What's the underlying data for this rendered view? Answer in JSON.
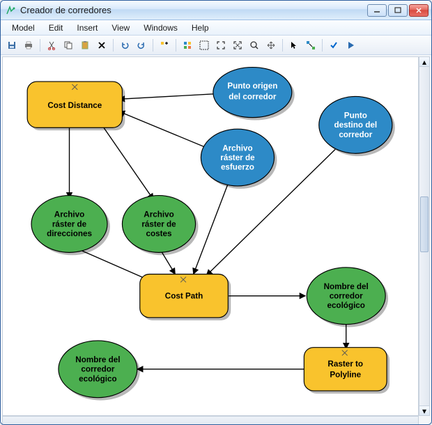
{
  "window": {
    "title": "Creador de corredores"
  },
  "menu": {
    "model": "Model",
    "edit": "Edit",
    "insert": "Insert",
    "view": "View",
    "windows": "Windows",
    "help": "Help"
  },
  "toolbar_icons": {
    "save": "save-icon",
    "print": "print-icon",
    "cut": "cut-icon",
    "copy": "copy-icon",
    "paste": "paste-icon",
    "delete": "delete-icon",
    "undo": "undo-icon",
    "redo": "redo-icon",
    "add": "add-icon",
    "grid": "grid-icon",
    "select_all": "select-all-icon",
    "fit": "fit-icon",
    "zoom_extent": "zoom-extent-icon",
    "zoom_in": "zoom-in-icon",
    "pan": "pan-icon",
    "pointer": "pointer-icon",
    "connect": "connect-icon",
    "validate": "validate-icon",
    "run": "run-icon"
  },
  "nodes": {
    "cost_distance": "Cost Distance",
    "punto_origen": "Punto origen\ndel corredor",
    "punto_destino": "Punto\ndestino del\ncorredor",
    "archivo_esfuerzo": "Archivo\nráster de\nesfuerzo",
    "archivo_direcciones": "Archivo\nráster de\ndirecciones",
    "archivo_costes": "Archivo\nráster de\ncostes",
    "cost_path": "Cost Path",
    "nombre_corredor_1": "Nombre del\ncorredor\necológico",
    "raster_to_polyline": "Raster to\nPolyline",
    "nombre_corredor_2": "Nombre del\ncorredor\necológico"
  }
}
